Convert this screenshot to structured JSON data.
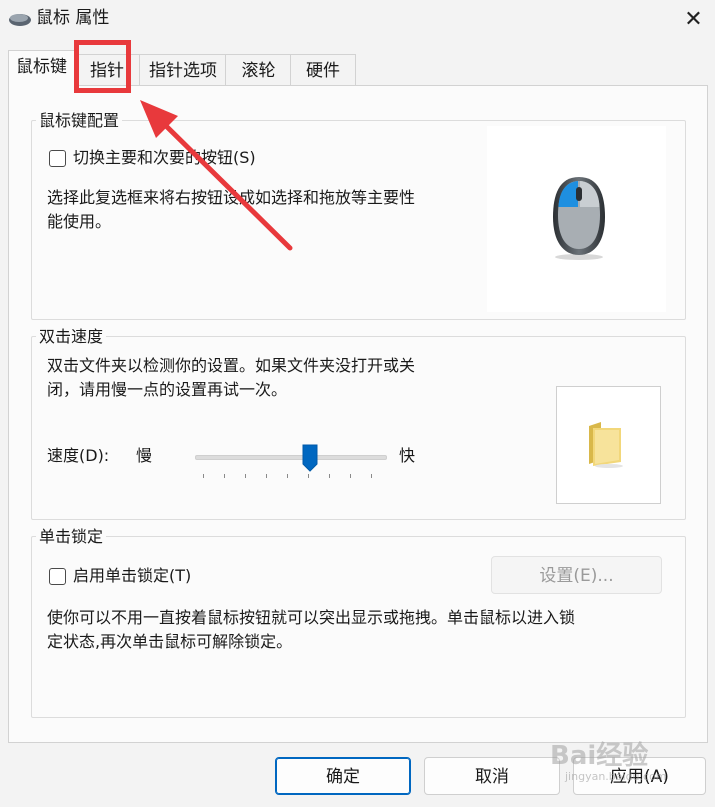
{
  "window": {
    "title": "鼠标 属性",
    "close_glyph": "✕"
  },
  "tabs": [
    {
      "label": "鼠标键",
      "active": true
    },
    {
      "label": "指针",
      "active": false
    },
    {
      "label": "指针选项",
      "active": false
    },
    {
      "label": "滚轮",
      "active": false
    },
    {
      "label": "硬件",
      "active": false
    }
  ],
  "button_config": {
    "title": "鼠标键配置",
    "swap_checkbox_label": "切换主要和次要的按钮(S)",
    "swap_checked": false,
    "description_line1": "选择此复选框来将右按钮设成如选择和拖放等主要性",
    "description_line2": "能使用。"
  },
  "double_click": {
    "title": "双击速度",
    "description_line1": "双击文件夹以检测你的设置。如果文件夹没打开或关",
    "description_line2": "闭，请用慢一点的设置再试一次。",
    "speed_label": "速度(D):",
    "slow_label": "慢",
    "fast_label": "快",
    "speed_fraction": 0.6
  },
  "click_lock": {
    "title": "单击锁定",
    "checkbox_label": "启用单击锁定(T)",
    "checked": false,
    "settings_button": "设置(E)...",
    "description_line1": "使你可以不用一直按着鼠标按钮就可以突出显示或拖拽。单击鼠标以进入锁",
    "description_line2": "定状态,再次单击鼠标可解除锁定。"
  },
  "footer": {
    "ok_label": "确定",
    "cancel_label": "取消",
    "apply_label": "应用(A)"
  },
  "watermark": {
    "brand": "Bai经验",
    "sub": "jingyan.baidu.com"
  },
  "colors": {
    "accent": "#0067c0",
    "annotation_red": "#e8393c",
    "mouse_blue": "#1e8fe0"
  },
  "icons": {
    "app": "mouse-icon",
    "mouse_preview": "mouse-icon",
    "test_folder": "folder-icon"
  }
}
